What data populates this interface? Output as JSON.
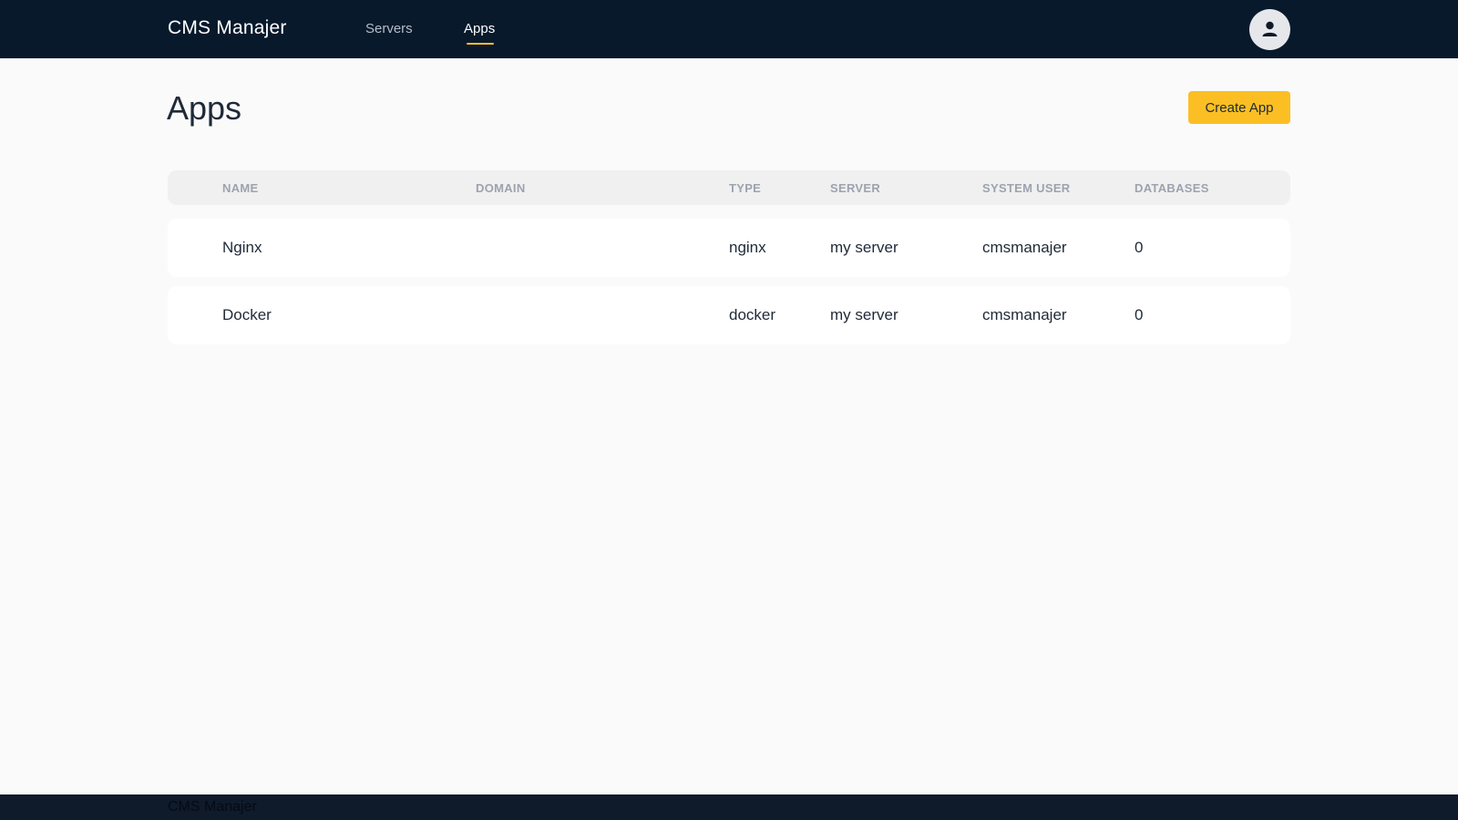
{
  "colors": {
    "topbar": "#08192c",
    "accent": "#fbbf24",
    "background": "#fafafa",
    "footer": "#0f1a2b"
  },
  "header": {
    "brand": "CMS Manajer",
    "nav": [
      {
        "label": "Servers",
        "active": false
      },
      {
        "label": "Apps",
        "active": true
      }
    ],
    "avatar_icon": "user-icon"
  },
  "main": {
    "title": "Apps",
    "create_button": "Create App",
    "table": {
      "columns": [
        "NAME",
        "DOMAIN",
        "TYPE",
        "SERVER",
        "SYSTEM USER",
        "DATABASES"
      ],
      "rows": [
        {
          "name": "Nginx",
          "domain": "",
          "type": "nginx",
          "server": "my server",
          "system_user": "cmsmanajer",
          "databases": "0"
        },
        {
          "name": "Docker",
          "domain": "",
          "type": "docker",
          "server": "my server",
          "system_user": "cmsmanajer",
          "databases": "0"
        }
      ]
    }
  },
  "footer": {
    "text": "CMS Manajer"
  }
}
